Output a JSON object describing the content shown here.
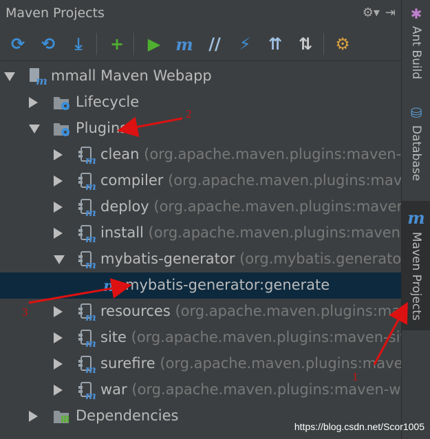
{
  "panel": {
    "title": "Maven Projects"
  },
  "titlebar_icons": [
    "gear-icon",
    "pin-hide-icon"
  ],
  "toolbar": {
    "buttons": [
      {
        "name": "reimport-icon",
        "glyph": "⟳",
        "color": "#3d8fd8"
      },
      {
        "name": "generate-sources-icon",
        "glyph": "⟲",
        "color": "#3d8fd8"
      },
      {
        "name": "download-icon",
        "glyph": "⤓",
        "color": "#3d8fd8"
      },
      {
        "name": "add-icon",
        "glyph": "+",
        "color": "#4fb030"
      },
      {
        "name": "run-icon",
        "glyph": "▶",
        "color": "#4fb030"
      },
      {
        "name": "execute-goal-icon",
        "glyph": "m",
        "color": "#4a8fd4"
      },
      {
        "name": "toggle-offline-icon",
        "glyph": "//",
        "color": "#a0c0e0"
      },
      {
        "name": "skip-tests-icon",
        "glyph": "⚡",
        "color": "#3d8fd8"
      },
      {
        "name": "show-dependencies-icon",
        "glyph": "⇈",
        "color": "#a0c0e0"
      },
      {
        "name": "collapse-all-icon",
        "glyph": "⇅",
        "color": "#cccccc"
      },
      {
        "name": "settings-icon",
        "glyph": "⚙",
        "color": "#d8a040"
      }
    ]
  },
  "tree": [
    {
      "label": "mmall Maven Webapp",
      "sub": "",
      "arrow": "down",
      "icon": "maven-module"
    },
    {
      "label": "Lifecycle",
      "sub": "",
      "arrow": "right",
      "icon": "folder-gear"
    },
    {
      "label": "Plugins",
      "sub": "",
      "arrow": "down",
      "icon": "folder-gear"
    },
    {
      "label": "clean",
      "sub": "(org.apache.maven.plugins:maven-cle",
      "arrow": "right",
      "icon": "plugin"
    },
    {
      "label": "compiler",
      "sub": "(org.apache.maven.plugins:maven-c",
      "arrow": "right",
      "icon": "plugin"
    },
    {
      "label": "deploy",
      "sub": "(org.apache.maven.plugins:maven-d",
      "arrow": "right",
      "icon": "plugin"
    },
    {
      "label": "install",
      "sub": "(org.apache.maven.plugins:maven-ins",
      "arrow": "right",
      "icon": "plugin"
    },
    {
      "label": "mybatis-generator",
      "sub": "(org.mybatis.generator:m",
      "arrow": "down",
      "icon": "plugin"
    },
    {
      "label": "mybatis-generator:generate",
      "sub": "",
      "arrow": "none",
      "icon": "goal",
      "selected": true
    },
    {
      "label": "resources",
      "sub": "(org.apache.maven.plugins:maven",
      "arrow": "right",
      "icon": "plugin"
    },
    {
      "label": "site",
      "sub": "(org.apache.maven.plugins:maven-site-p",
      "arrow": "right",
      "icon": "plugin"
    },
    {
      "label": "surefire",
      "sub": "(org.apache.maven.plugins:maven-s",
      "arrow": "right",
      "icon": "plugin"
    },
    {
      "label": "war",
      "sub": "(org.apache.maven.plugins:maven-war-",
      "arrow": "right",
      "icon": "plugin"
    },
    {
      "label": "Dependencies",
      "sub": "",
      "arrow": "right",
      "icon": "folder-deps"
    }
  ],
  "side_tabs": [
    {
      "label": "Ant Build",
      "icon": "ant-icon"
    },
    {
      "label": "Database",
      "icon": "database-icon"
    },
    {
      "label": "Maven Projects",
      "icon": "maven-icon"
    }
  ],
  "annotations": {
    "number_1": "1",
    "number_2": "2",
    "number_3": "3",
    "color": "#dd1111"
  },
  "watermark": "https://blog.csdn.net/Scor1005"
}
